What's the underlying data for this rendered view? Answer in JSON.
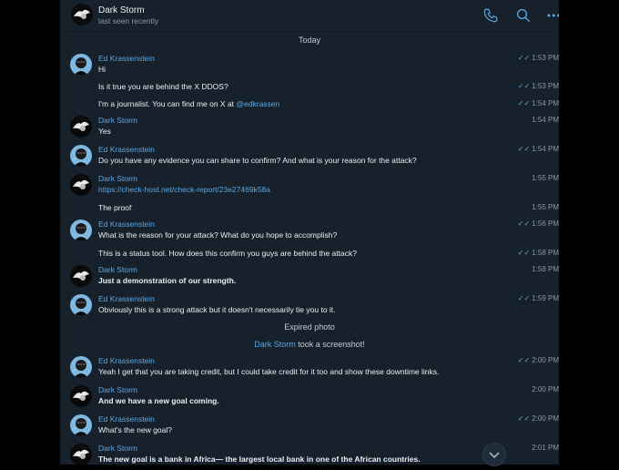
{
  "header": {
    "name": "Dark Storm",
    "status": "last seen recently"
  },
  "day": "Today",
  "messages": [
    {
      "sender": "Ed Krassenstein",
      "text": "Hi",
      "time": "1:53 PM"
    },
    {
      "text": "Is it true you are behind the X DDOS?",
      "time": "1:53 PM"
    },
    {
      "text_pre": "I'm a journalist. You can find me on X at ",
      "mention": "@edkrassen",
      "time": "1:54 PM"
    },
    {
      "sender": "Dark Storm",
      "text": "Yes",
      "time": "1:54 PM"
    },
    {
      "sender": "Ed Krassenstein",
      "text": "Do you have any evidence you can share to confirm?  And what is your reason for the attack?",
      "time": "1:54 PM"
    },
    {
      "sender": "Dark Storm",
      "link": "https://check-host.net/check-report/23e27469k58a",
      "time": "1:55 PM"
    },
    {
      "text": "The proof",
      "time": "1:55 PM"
    },
    {
      "sender": "Ed Krassenstein",
      "text": "What is the reason for your attack?  What do you hope to accomplish?",
      "time": "1:56 PM"
    },
    {
      "text": "This is a status tool.  How does this confirm you guys are behind the attack?",
      "time": "1:58 PM"
    },
    {
      "sender": "Dark Storm",
      "text": "Just a demonstration of our strength.",
      "time": "1:58 PM"
    },
    {
      "sender": "Ed Krassenstein",
      "text": "Obviously this is a strong attack but it doesn't necessarily tie you to it.",
      "time": "1:59 PM"
    },
    {
      "sender": "Ed Krassenstein",
      "text": "Yeah I get that you are taking credit, but I could take credit for it too and show these downtime links.",
      "time": "2:00 PM"
    },
    {
      "sender": "Dark Storm",
      "text": "And we have a new goal coming.",
      "time": "2:00 PM"
    },
    {
      "sender": "Ed Krassenstein",
      "text": "What's the new goal?",
      "time": "2:00 PM"
    },
    {
      "sender": "Dark Storm",
      "text": "The new goal is a bank in Africa— the largest local bank in one of the African countries.",
      "time": "2:01 PM"
    }
  ],
  "service": {
    "expired_photo": "Expired photo",
    "screenshot_name": "Dark Storm",
    "screenshot_text": " took a screenshot!"
  },
  "colors": {
    "accent": "#5aa8e6",
    "background": "#17212b",
    "text": "#e9eef3"
  },
  "icons": [
    "phone-icon",
    "search-icon",
    "more-icon",
    "double-check-icon",
    "chevron-down-icon"
  ]
}
